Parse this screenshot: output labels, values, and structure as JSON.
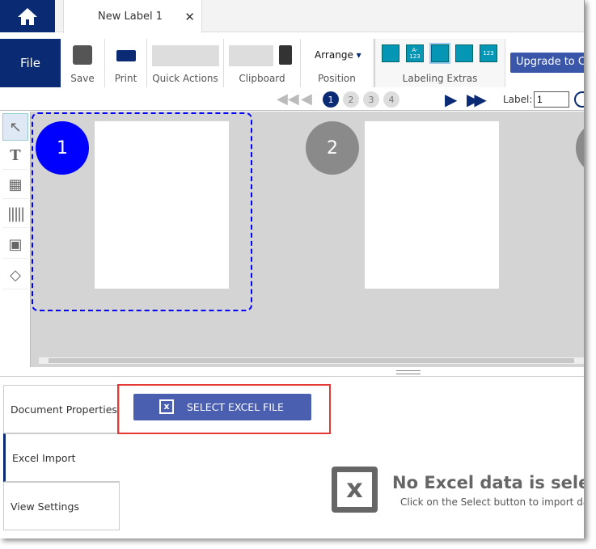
{
  "tabs": {
    "document": "New Label 1",
    "close": "✕"
  },
  "ribbon": {
    "file": "File",
    "save": "Save",
    "print": "Print",
    "quick_actions": "Quick Actions",
    "clipboard": "Clipboard",
    "arrange": "Arrange",
    "position": "Position",
    "labeling_extras": "Labeling Extras",
    "upgrade": "Upgrade to Custom",
    "extras_icons": [
      "database-icon",
      "a-123-icon",
      "excel-import-icon",
      "barcode-serial-icon",
      "numbering-123-icon"
    ],
    "extra_texts": [
      "",
      "A-123",
      "",
      "",
      "123"
    ]
  },
  "nav": {
    "pages": [
      "1",
      "2",
      "3",
      "4"
    ],
    "current_page": "1",
    "label_caption": "Label:",
    "label_value": "1"
  },
  "canvas": {
    "labels": [
      "1",
      "2"
    ],
    "selected": "1",
    "selected_color": "#0000ff",
    "unselected_color": "#8a8a8a"
  },
  "bottom": {
    "side_tabs": [
      "Document Properties",
      "Excel Import",
      "View Settings"
    ],
    "active_tab": "Excel Import",
    "select_button": "SELECT EXCEL FILE",
    "empty_title": "No Excel data is selected",
    "empty_hint": "Click on the Select button to import data"
  },
  "colors": {
    "brand": "#0a2a73",
    "button": "#4a5fb0",
    "highlight": "#e53935"
  }
}
